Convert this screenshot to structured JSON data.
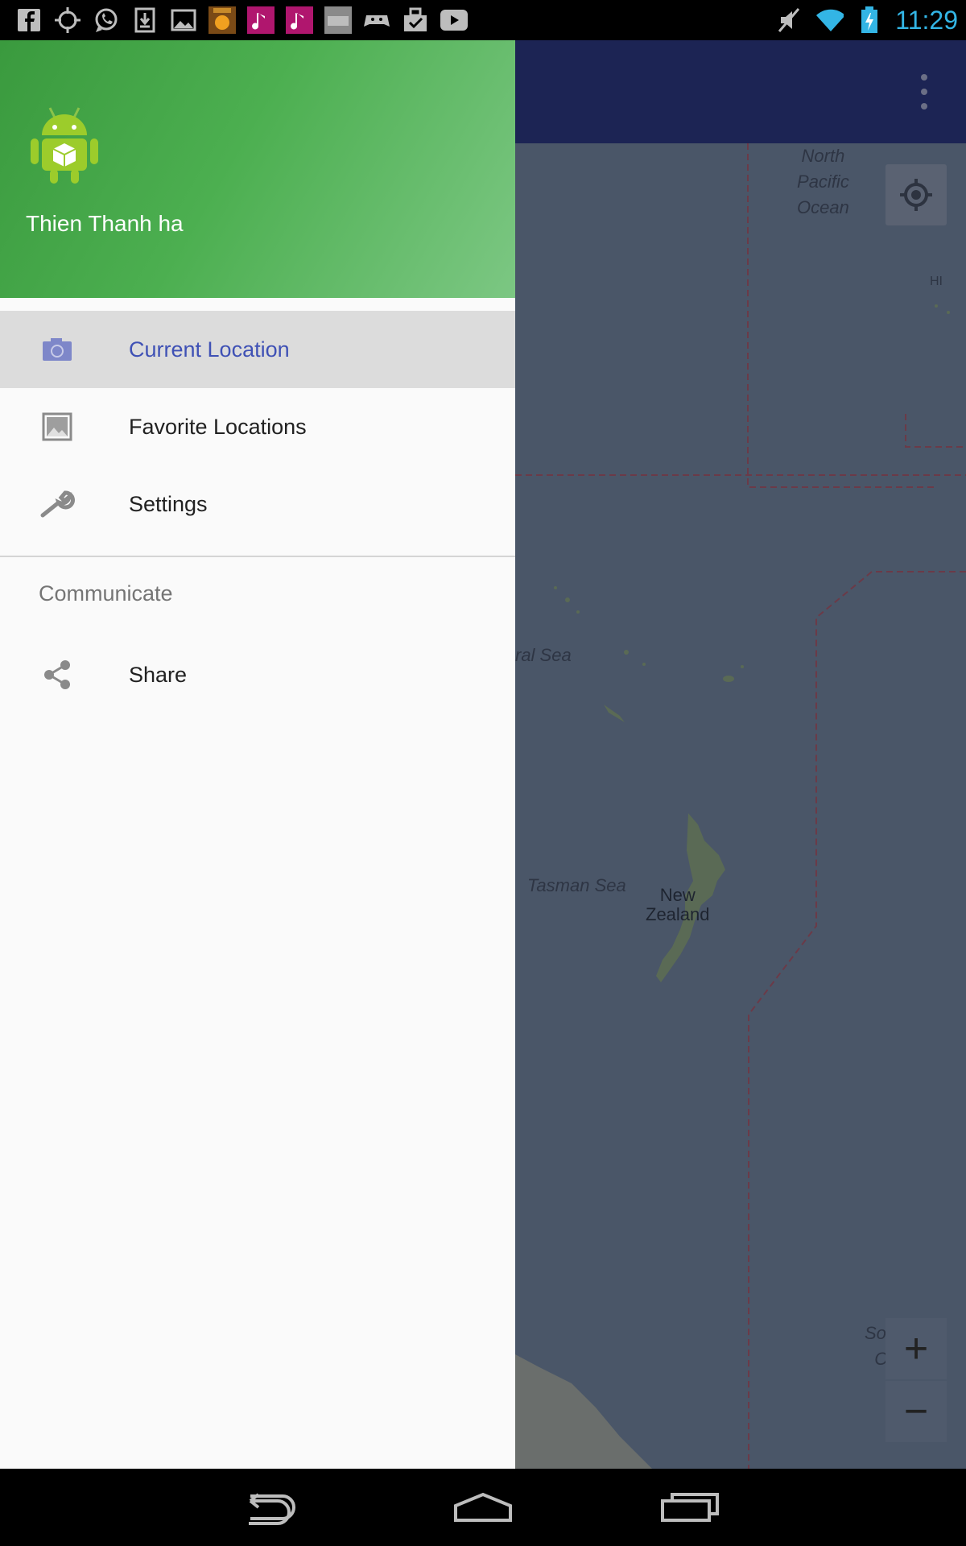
{
  "status_bar": {
    "time": "11:29",
    "notification_icons": [
      "facebook-icon",
      "gps-icon",
      "whatsapp-icon",
      "download-icon",
      "image-icon",
      "toefl-icon",
      "music-icon",
      "music-icon",
      "showroomprive-icon",
      "game-controller-icon",
      "task-icon",
      "youtube-icon"
    ],
    "system_icons": [
      "mute-icon",
      "wifi-icon",
      "battery-charging-icon"
    ],
    "time_color": "#33b5e5"
  },
  "map": {
    "labels": {
      "north_pacific": "North\nPacific\nOcean",
      "hawaii": "HI",
      "coral_sea": "ral Sea",
      "tasman_sea": "Tasman Sea",
      "new_zealand": "New\nZealand",
      "southern_ocean": "Southern\nOcean"
    },
    "zoom_in": "+",
    "zoom_out": "−"
  },
  "drawer": {
    "header": {
      "username": "Thien Thanh ha",
      "gradient_start": "#3a9a3e",
      "gradient_end": "#7cc783"
    },
    "items": [
      {
        "label": "Current Location",
        "icon": "camera-icon",
        "active": true
      },
      {
        "label": "Favorite Locations",
        "icon": "image-icon",
        "active": false
      },
      {
        "label": "Settings",
        "icon": "wrench-icon",
        "active": false
      }
    ],
    "section": {
      "title": "Communicate",
      "items": [
        {
          "label": "Share",
          "icon": "share-icon"
        }
      ]
    },
    "accent_color": "#3f51b5"
  },
  "nav_bar": {
    "buttons": [
      "back-icon",
      "home-icon",
      "recents-icon"
    ]
  }
}
